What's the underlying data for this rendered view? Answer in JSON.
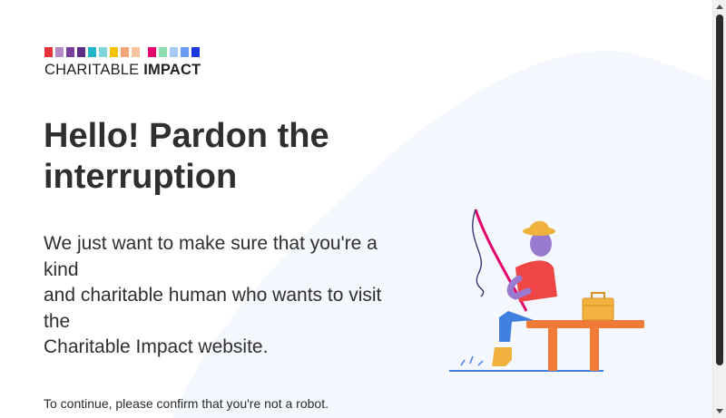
{
  "brand": {
    "name_regular": "CHARITABLE",
    "name_bold": "IMPACT",
    "color_strip": [
      "#e8333c",
      "#b48bc8",
      "#7a3e9d",
      "#5b2f86",
      "#1fb7c9",
      "#7ed6db",
      "#f5c400",
      "#f2a57a",
      "#f7c6a0",
      "#e8006f",
      "#8fdcb0",
      "#a5c8f5",
      "#6a9cf5",
      "#1837e0"
    ]
  },
  "heading": "Hello! Pardon the interruption",
  "lede": {
    "line1": "We just want to make sure that you're a kind",
    "line2": "and charitable human who wants to visit the",
    "line3": "Charitable Impact website."
  },
  "confirm_text": "To continue, please confirm that you're not a robot.",
  "illustration": {
    "name": "person-fishing-illustration",
    "colors": {
      "shirt": "#f04545",
      "pants": "#3f7fe0",
      "hat": "#f0b23c",
      "skin": "#9a7ad0",
      "bench": "#f07a38",
      "basket": "#f3b340"
    }
  },
  "background_blob_color": "#f4f7fd"
}
